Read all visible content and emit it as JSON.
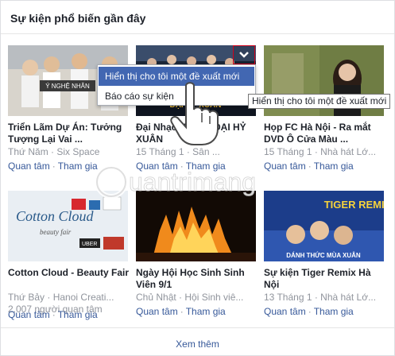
{
  "panel": {
    "title": "Sự kiện phổ biến gần đây"
  },
  "events": [
    {
      "title": "Triển Lãm Dự Án: Tưởng Tượng Lại Vai ...",
      "meta": "Thứ Năm · Six Space",
      "interested": "Quan tâm",
      "join": "Tham gia",
      "thumb_text": "Ý NGHỆ NHÂN"
    },
    {
      "title": "Đại Nhạc Hội ... - ĐẠI HỶ XUÂN",
      "meta": "15 Tháng 1 · Sân ...",
      "interested": "Quan tâm",
      "join": "Tham gia",
      "thumb_text": ""
    },
    {
      "title": "Họp FC Hà Nội - Ra mắt DVD Ô Cửa Màu ...",
      "meta": "15 Tháng 1 · Nhà hát Lớ...",
      "interested": "Quan tâm",
      "join": "Tham gia",
      "thumb_text": ""
    },
    {
      "title": "Cotton Cloud - Beauty Fair",
      "meta": "Thứ Bảy · Hanoi Creati...",
      "extra": "2.007 người quan tâm",
      "interested": "Quan tâm",
      "join": "Tham gia",
      "thumb_text": "Cotton Cloud"
    },
    {
      "title": "Ngày Hội Học Sinh Sinh Viên 9/1",
      "meta": "Chủ Nhật · Hội Sinh viê...",
      "interested": "Quan tâm",
      "join": "Tham gia",
      "thumb_text": ""
    },
    {
      "title": "Sự kiện Tiger Remix Hà Nội",
      "meta": "13 Tháng 1 · Nhà hát Lớ...",
      "interested": "Quan tâm",
      "join": "Tham gia",
      "thumb_text": "TIGER REMIX"
    }
  ],
  "menu": {
    "suggest_label": "Hiển thị cho tôi một đề xuất mới",
    "report_label": "Báo cáo sự kiện"
  },
  "tooltip": "Hiển thị cho tôi một đề xuất mới",
  "see_more": "Xem thêm",
  "watermark": "uantrimang",
  "colors": {
    "accent": "#4267b2",
    "link": "#365899",
    "meta": "#90949c"
  }
}
